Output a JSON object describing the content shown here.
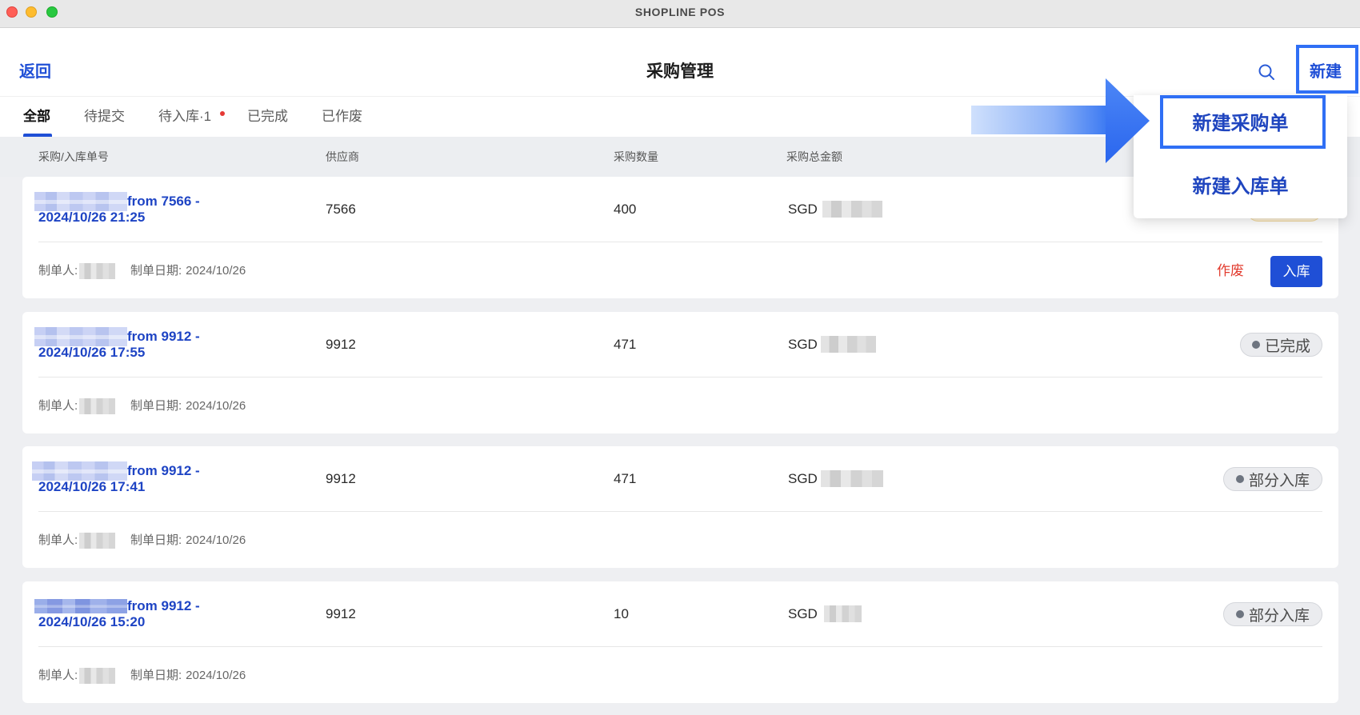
{
  "window": {
    "title": "SHOPLINE POS"
  },
  "header": {
    "back_label": "返回",
    "title": "采购管理",
    "new_label": "新建",
    "icons": {
      "search": "search-icon"
    }
  },
  "tabs": [
    {
      "label": "全部",
      "active": true
    },
    {
      "label": "待提交",
      "active": false
    },
    {
      "label": "待入库·1",
      "active": false,
      "notification_dot": true
    },
    {
      "label": "已完成",
      "active": false
    },
    {
      "label": "已作废",
      "active": false
    }
  ],
  "table": {
    "columns": {
      "order_no": "采购/入库单号",
      "supplier": "供应商",
      "quantity": "采购数量",
      "total_amount": "采购总金额"
    },
    "rows": [
      {
        "order_no_suffix": "from 7566 -",
        "order_datetime": "2024/10/26 21:25",
        "supplier": "7566",
        "quantity": 400,
        "currency": "SGD",
        "creator_label": "制单人:",
        "created_date_label": "制单日期:",
        "created_date": "2024/10/26",
        "actions": {
          "void_label": "作废",
          "receive_label": "入库"
        }
      },
      {
        "order_no_suffix": "from 9912 -",
        "order_datetime": "2024/10/26 17:55",
        "supplier": "9912",
        "quantity": 471,
        "currency": "SGD",
        "creator_label": "制单人:",
        "created_date_label": "制单日期:",
        "created_date": "2024/10/26",
        "status": "已完成"
      },
      {
        "order_no_suffix": "from 9912 -",
        "order_datetime": "2024/10/26 17:41",
        "supplier": "9912",
        "quantity": 471,
        "currency": "SGD",
        "creator_label": "制单人:",
        "created_date_label": "制单日期:",
        "created_date": "2024/10/26",
        "status": "部分入库"
      },
      {
        "order_no_suffix": "from 9912 -",
        "order_datetime": "2024/10/26 15:20",
        "supplier": "9912",
        "quantity": 10,
        "currency": "SGD",
        "creator_label": "制单人:",
        "created_date_label": "制单日期:",
        "created_date": "2024/10/26",
        "status": "部分入库"
      }
    ]
  },
  "new_menu": {
    "items": [
      {
        "label": "新建采购单",
        "highlighted": true
      },
      {
        "label": "新建入库单",
        "highlighted": false
      }
    ]
  },
  "colors": {
    "brand_blue": "#1f4fd6",
    "link_blue": "#1e44c4",
    "annotation_blue": "#2f6ff5",
    "void_red": "#e23b2e",
    "notification_red": "#e53935",
    "page_background": "#eeeff2"
  }
}
